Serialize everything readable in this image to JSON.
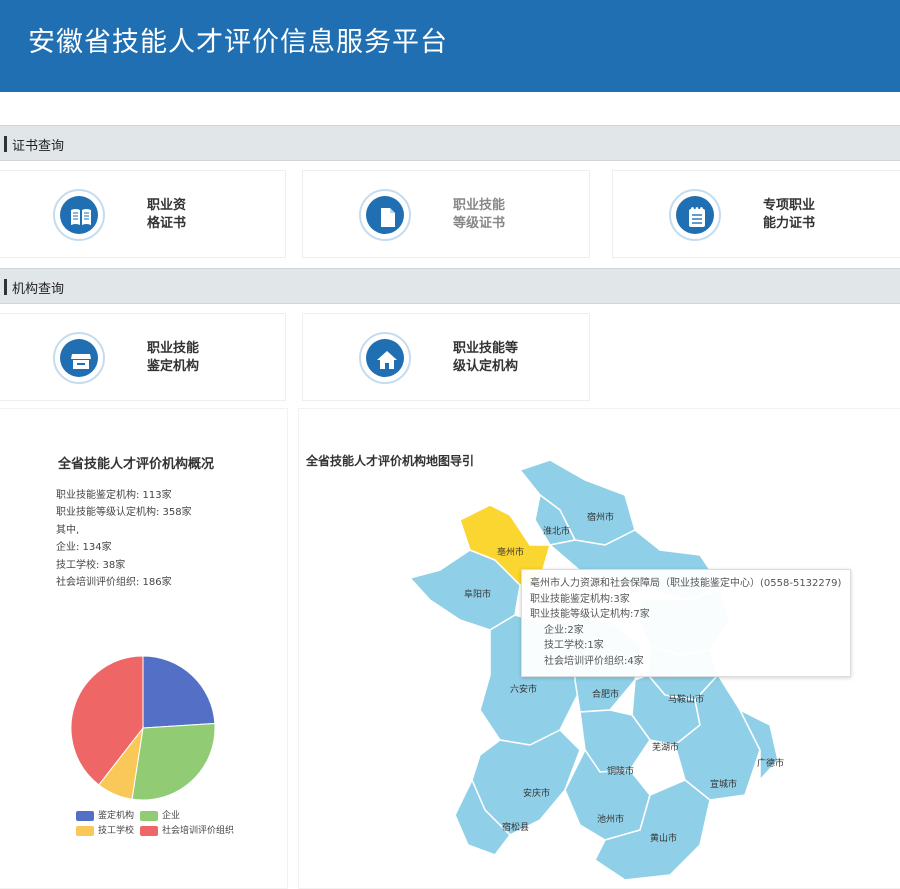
{
  "header": {
    "title": "安徽省技能人才评价信息服务平台"
  },
  "sections": {
    "certificates": "证书查询",
    "institutions": "机构查询"
  },
  "cards": {
    "cert1": {
      "line1": "职业资",
      "line2": "格证书",
      "icon": "open-book-icon"
    },
    "cert2": {
      "line1": "职业技能",
      "line2": "等级证书",
      "icon": "document-icon"
    },
    "cert3": {
      "line1": "专项职业",
      "line2": "能力证书",
      "icon": "notepad-icon"
    },
    "inst1": {
      "line1": "职业技能",
      "line2": "鉴定机构",
      "icon": "storefront-icon"
    },
    "inst2": {
      "line1": "职业技能等",
      "line2": "级认定机构",
      "icon": "house-icon"
    }
  },
  "overview": {
    "title": "全省技能人才评价机构概况",
    "lines": [
      "职业技能鉴定机构: 113家",
      "职业技能等级认定机构: 358家",
      "其中,",
      "企业: 134家",
      "技工学校: 38家",
      "社会培训评价组织: 186家"
    ]
  },
  "chart_data": {
    "type": "pie",
    "slices": [
      {
        "label": "鉴定机构",
        "value": 113,
        "color": "#5470c6"
      },
      {
        "label": "企业",
        "value": 134,
        "color": "#91cc75"
      },
      {
        "label": "技工学校",
        "value": 38,
        "color": "#fac858"
      },
      {
        "label": "社会培训评价组织",
        "value": 186,
        "color": "#ee6666"
      }
    ],
    "legend_position": "bottom"
  },
  "map": {
    "title": "全省技能人才评价机构地图导引",
    "colors": {
      "region": "#8fd0e8",
      "highlight": "#fbd630",
      "border": "#ffffff"
    },
    "cities": [
      "宿州市",
      "淮北市",
      "亳州市",
      "阜阳市",
      "六安市",
      "合肥市",
      "马鞍山市",
      "芜湖市",
      "铜陵市",
      "宣城市",
      "广德市",
      "安庆市",
      "池州市",
      "黄山市",
      "宿松县"
    ],
    "tooltip": {
      "head": "亳州市人力资源和社会保障局（职业技能鉴定中心）(0558-5132279)",
      "line1": "职业技能鉴定机构:3家",
      "line2": "职业技能等级认定机构:7家",
      "sub1": "企业:2家",
      "sub2": "技工学校:1家",
      "sub3": "社会培训评价组织:4家"
    }
  }
}
